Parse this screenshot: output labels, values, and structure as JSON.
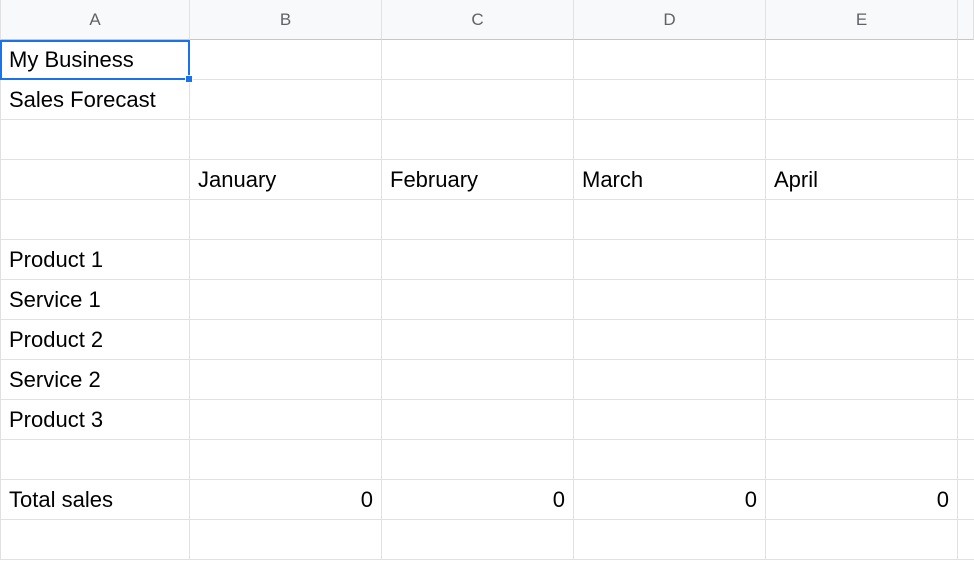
{
  "columns": [
    "A",
    "B",
    "C",
    "D",
    "E",
    ""
  ],
  "rows": [
    [
      "My Business",
      "",
      "",
      "",
      "",
      ""
    ],
    [
      "Sales Forecast",
      "",
      "",
      "",
      "",
      ""
    ],
    [
      "",
      "",
      "",
      "",
      "",
      ""
    ],
    [
      "",
      "January",
      "February",
      "March",
      "April",
      ""
    ],
    [
      "",
      "",
      "",
      "",
      "",
      ""
    ],
    [
      "Product 1",
      "",
      "",
      "",
      "",
      ""
    ],
    [
      "Service 1",
      "",
      "",
      "",
      "",
      ""
    ],
    [
      "Product 2",
      "",
      "",
      "",
      "",
      ""
    ],
    [
      "Service 2",
      "",
      "",
      "",
      "",
      ""
    ],
    [
      "Product 3",
      "",
      "",
      "",
      "",
      ""
    ],
    [
      "",
      "",
      "",
      "",
      "",
      ""
    ],
    [
      "Total sales",
      "0",
      "0",
      "0",
      "0",
      ""
    ],
    [
      "",
      "",
      "",
      "",
      "",
      ""
    ]
  ],
  "numericCells": [
    [
      11,
      1
    ],
    [
      11,
      2
    ],
    [
      11,
      3
    ],
    [
      11,
      4
    ]
  ],
  "selection": {
    "row": 0,
    "col": 0
  }
}
